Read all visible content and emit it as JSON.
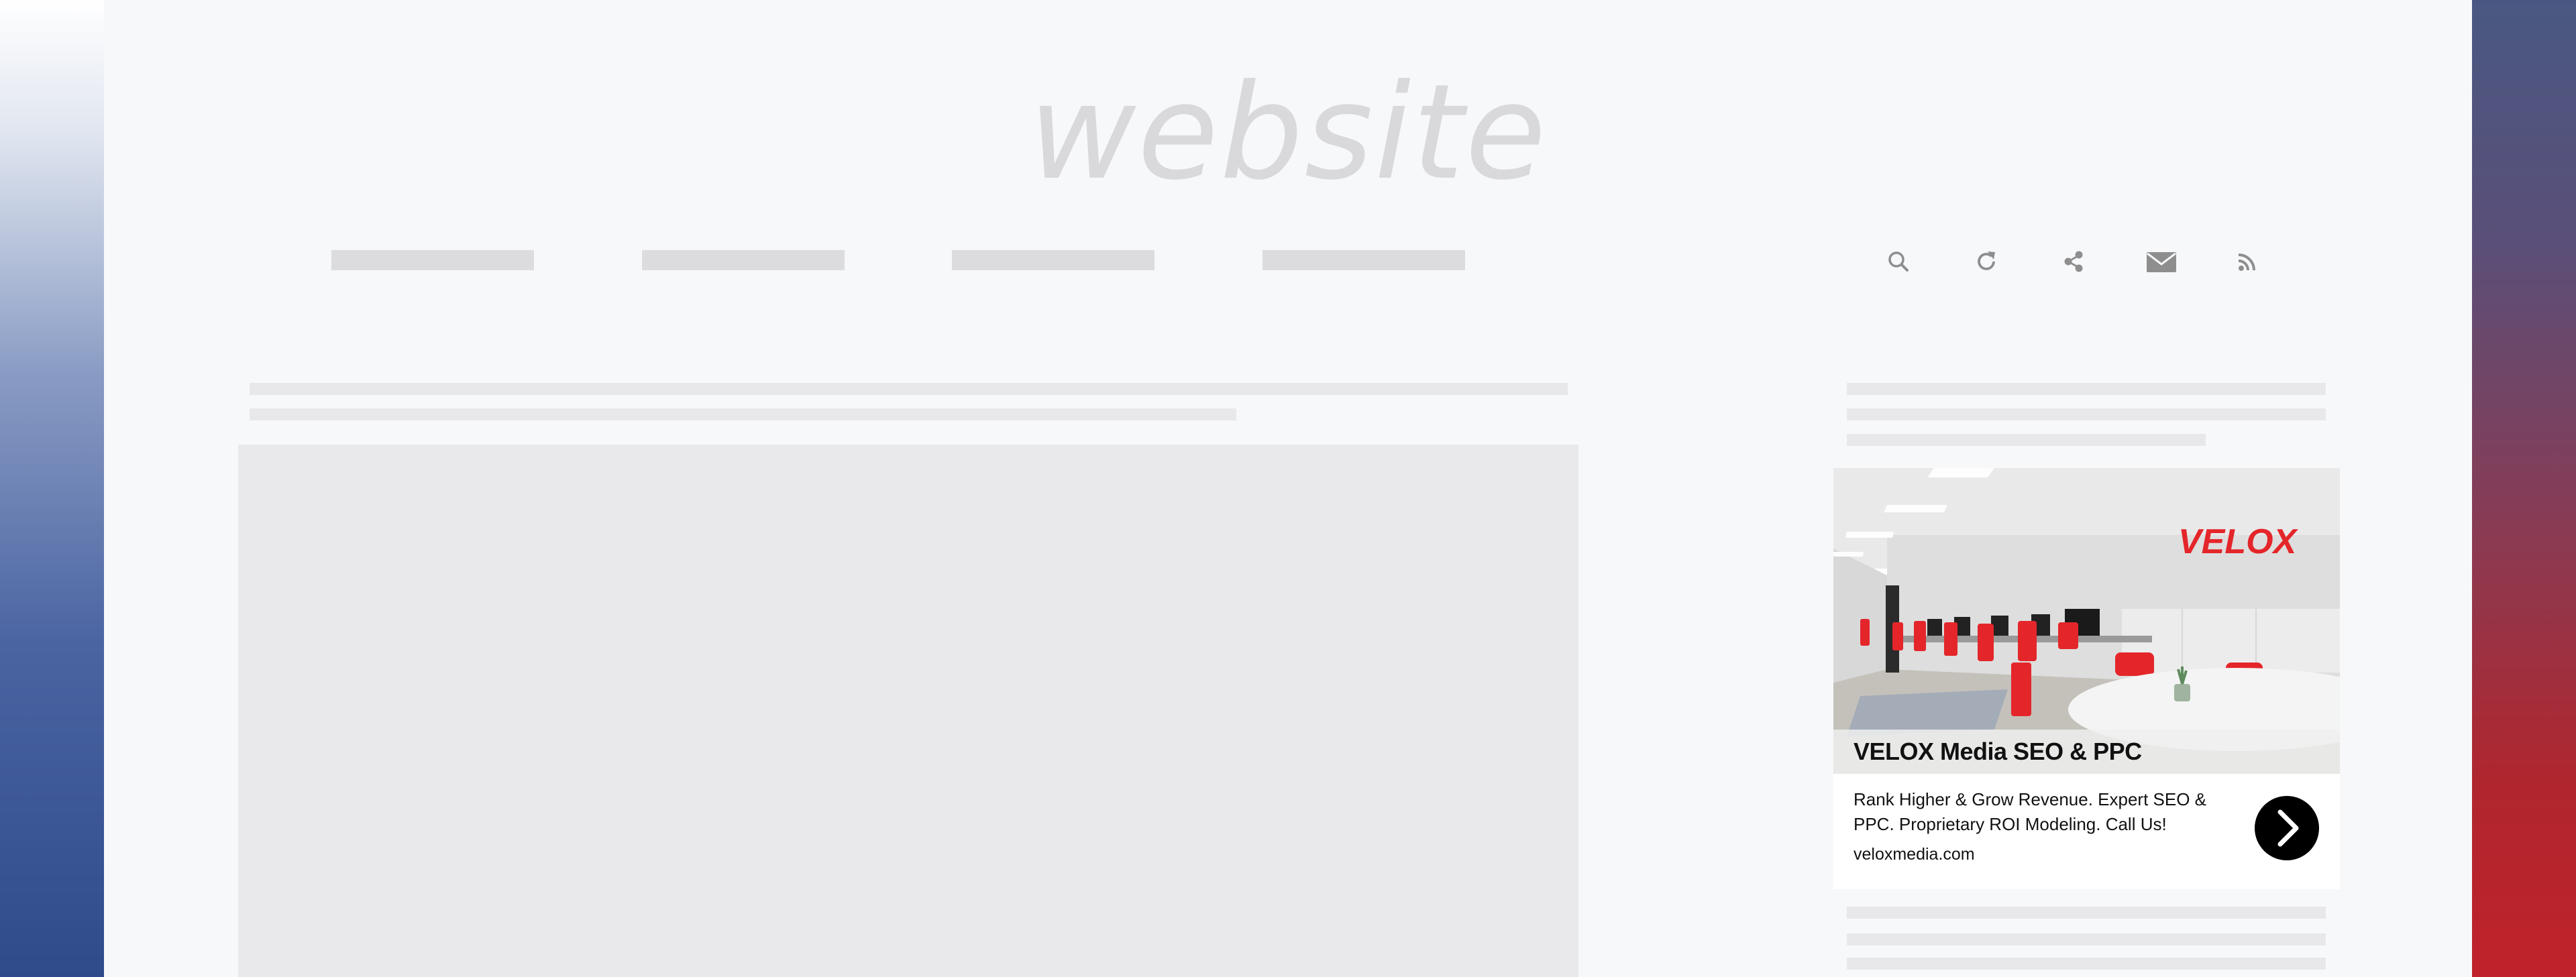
{
  "site": {
    "logo_text": "website"
  },
  "toolbar": {
    "icons": [
      "search-icon",
      "refresh-icon",
      "share-icon",
      "mail-icon",
      "rss-icon"
    ],
    "icon_color": "#8e8e8e"
  },
  "ad": {
    "title": "VELOX Media SEO & PPC",
    "description": "Rank Higher & Grow Revenue. Expert SEO & PPC. Proprietary ROI Modeling. Call Us!",
    "domain": "veloxmedia.com",
    "image_logo_text": "VELOX",
    "brand_color": "#e4262a"
  },
  "colors": {
    "placeholder": "#dcdcde",
    "page_background": "#f7f8fa"
  }
}
